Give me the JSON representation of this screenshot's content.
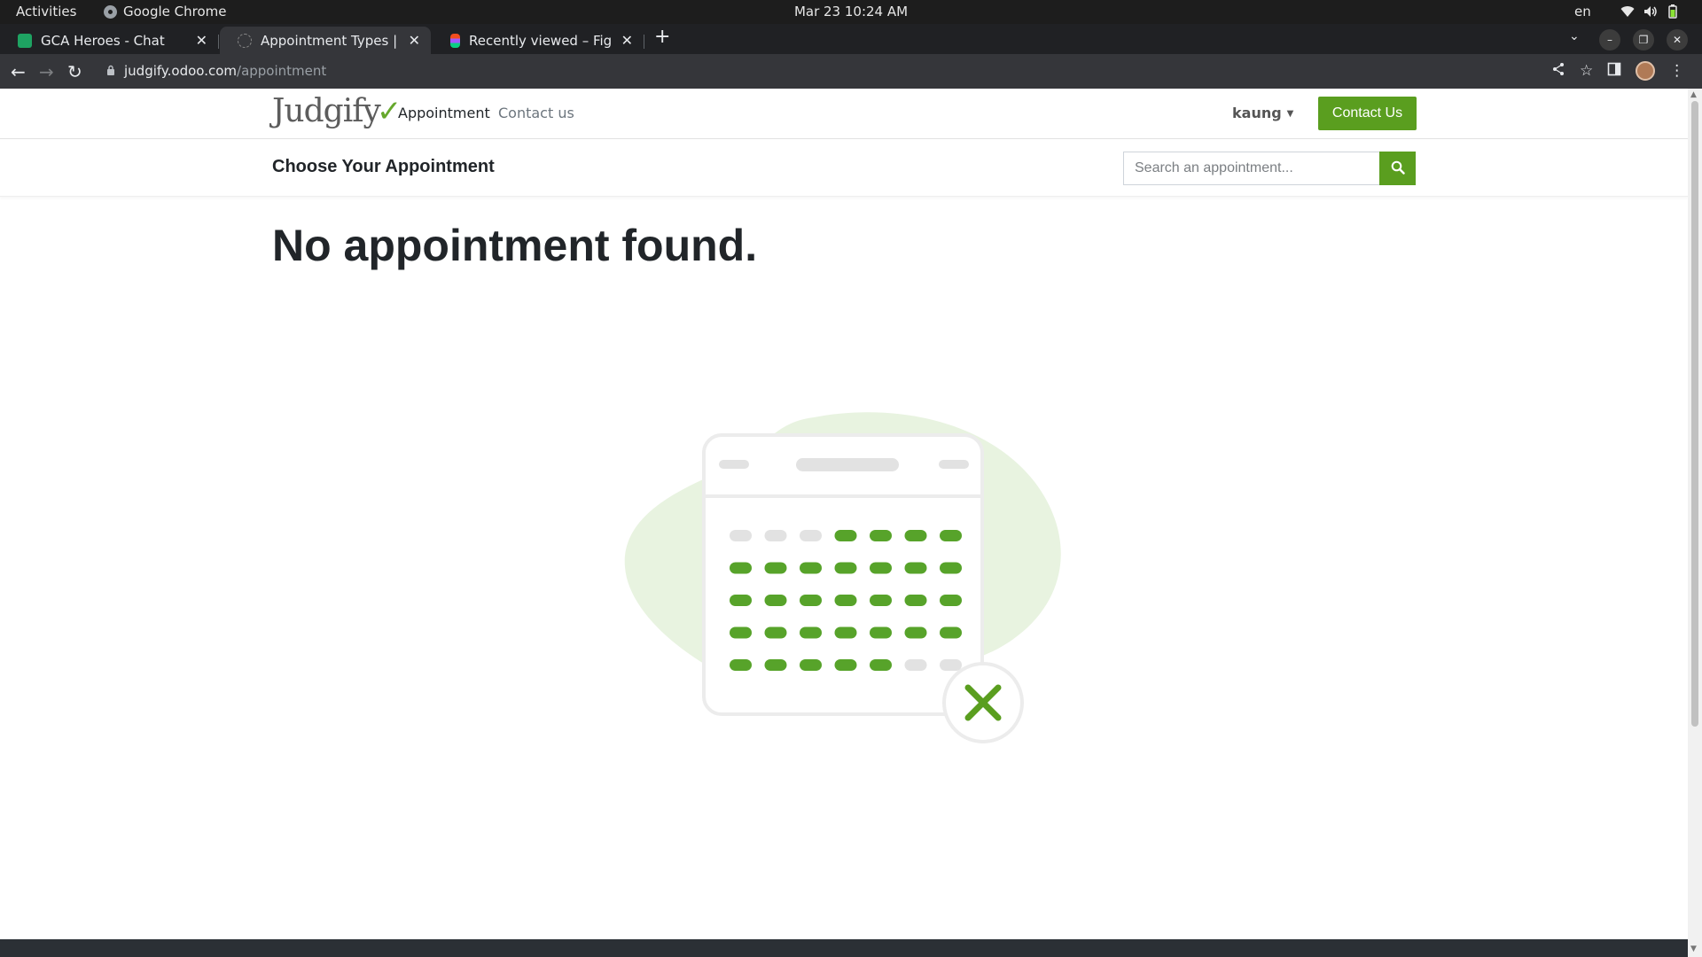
{
  "os_bar": {
    "activities": "Activities",
    "app_name": "Google Chrome",
    "clock": "Mar 23  10:24 AM",
    "lang": "en"
  },
  "browser": {
    "tabs": [
      {
        "title": "GCA Heroes - Chat",
        "active": false
      },
      {
        "title": "Appointment Types | Judgify",
        "active": true
      },
      {
        "title": "Recently viewed – Figma",
        "active": false
      }
    ],
    "url_host": "judgify.odoo.com",
    "url_path": "/appointment"
  },
  "site": {
    "logo_text": "Judgify",
    "nav": [
      {
        "label": "Appointment"
      },
      {
        "label": "Contact us"
      }
    ],
    "user_name": "kaung",
    "cta_label": "Contact Us"
  },
  "subheader": {
    "title": "Choose Your Appointment",
    "search_placeholder": "Search an appointment..."
  },
  "main": {
    "empty_message": "No appointment found."
  },
  "colors": {
    "brand_green": "#5a9e1f",
    "dot_green": "#57a32a",
    "dot_grey": "#e2e2e2",
    "blob": "#e8f3e0"
  }
}
